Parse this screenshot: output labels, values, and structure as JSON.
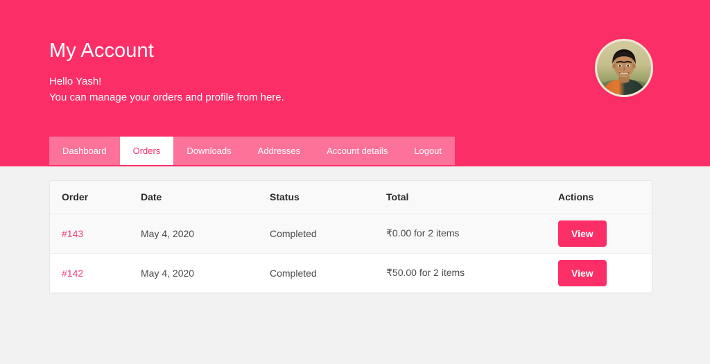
{
  "header": {
    "title": "My Account",
    "greeting": "Hello Yash!",
    "subtitle": "You can manage your orders and profile from here.",
    "avatar_name": "user-avatar",
    "background_color": "#fb2e68"
  },
  "tabs": [
    {
      "label": "Dashboard",
      "name": "tab-dashboard",
      "active": false
    },
    {
      "label": "Orders",
      "name": "tab-orders",
      "active": true
    },
    {
      "label": "Downloads",
      "name": "tab-downloads",
      "active": false
    },
    {
      "label": "Addresses",
      "name": "tab-addresses",
      "active": false
    },
    {
      "label": "Account details",
      "name": "tab-account-details",
      "active": false
    },
    {
      "label": "Logout",
      "name": "tab-logout",
      "active": false
    }
  ],
  "orders_table": {
    "columns": [
      "Order",
      "Date",
      "Status",
      "Total",
      "Actions"
    ],
    "rows": [
      {
        "order": "#143",
        "date": "May 4, 2020",
        "status": "Completed",
        "total": "₹0.00 for 2 items",
        "action_label": "View"
      },
      {
        "order": "#142",
        "date": "May 4, 2020",
        "status": "Completed",
        "total": "₹50.00 for 2 items",
        "action_label": "View"
      }
    ]
  },
  "colors": {
    "brand_pink": "#fb2e68",
    "link_pink": "#f0417a",
    "active_tab_text": "#f9316a",
    "page_background": "#f2f2f2",
    "row_alt_background": "#f9f9f9"
  }
}
